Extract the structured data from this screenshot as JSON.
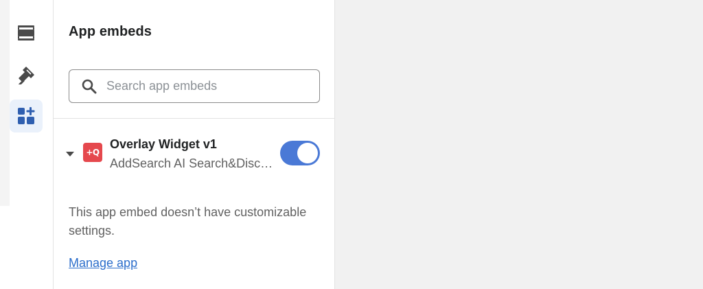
{
  "rail": {
    "items": [
      {
        "icon": "sections-icon",
        "active": false
      },
      {
        "icon": "theme-brush-icon",
        "active": false
      },
      {
        "icon": "app-embeds-icon",
        "active": true
      }
    ]
  },
  "panel": {
    "title": "App embeds",
    "search": {
      "placeholder": "Search app embeds",
      "value": ""
    },
    "embed": {
      "name": "Overlay Widget v1",
      "app_name": "AddSearch AI Search&Discovery",
      "logo_text": "+Q",
      "logo_color": "#e5484d",
      "enabled": true,
      "expanded": true
    },
    "info_text": "This app embed doesn’t have customizable settings.",
    "manage_link": "Manage app"
  },
  "colors": {
    "accent": "#4a79d6",
    "active_rail": "#eaf1fb",
    "link": "#2c6ecb",
    "icon_gray": "#4a4a4a"
  }
}
